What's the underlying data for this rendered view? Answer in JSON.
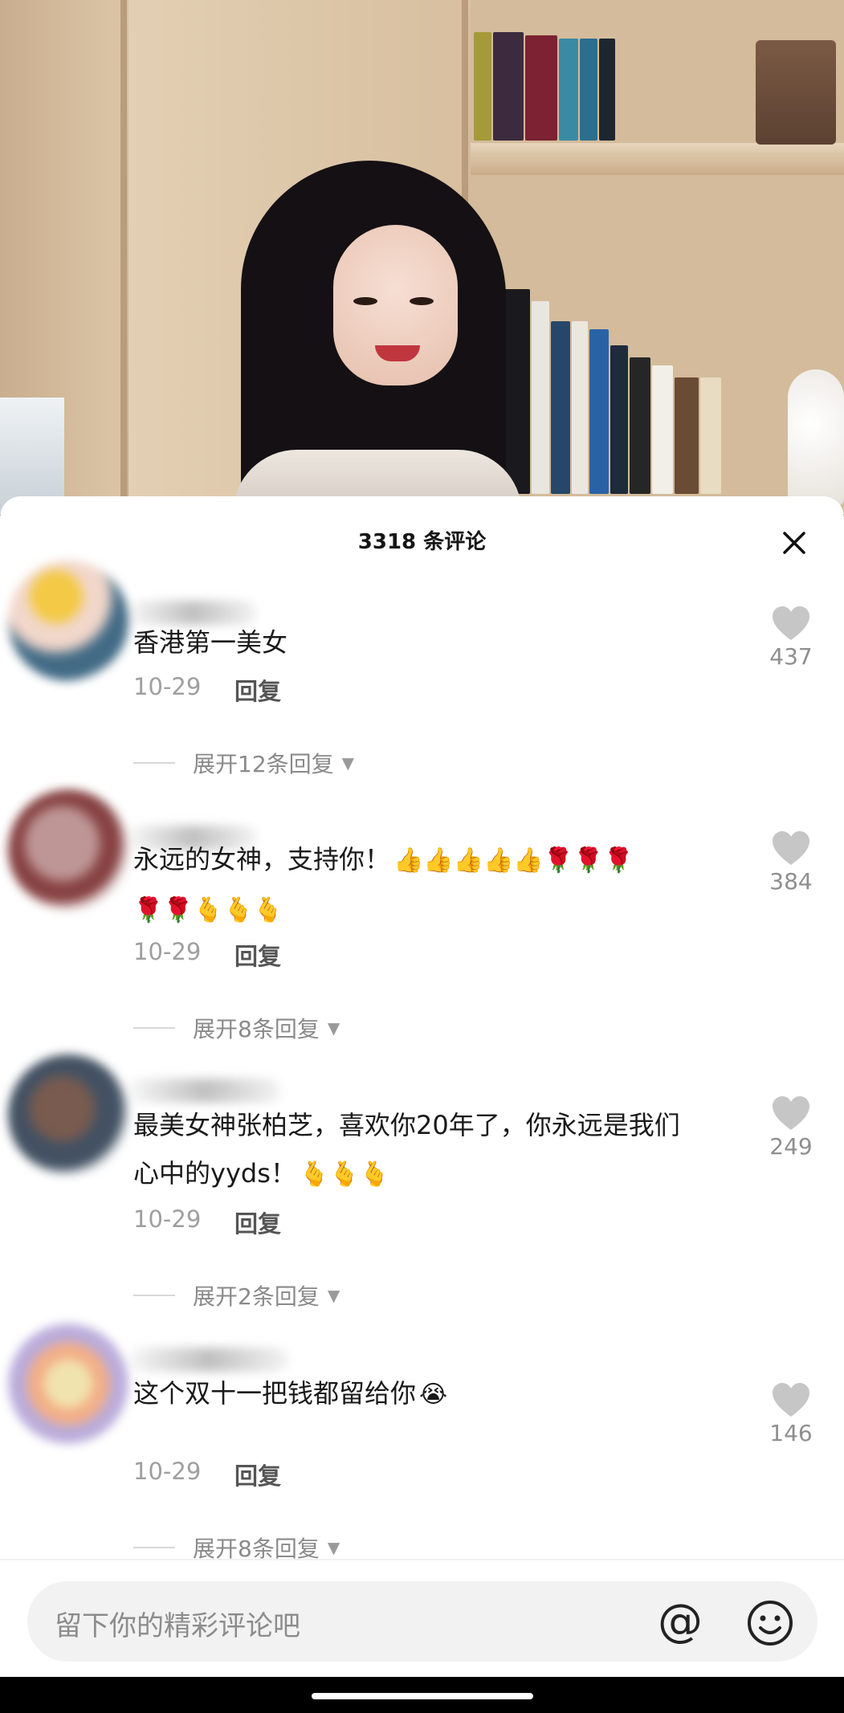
{
  "sheet": {
    "title": "3318 条评论"
  },
  "comments": [
    {
      "text": "香港第一美女",
      "emojis": "",
      "emojis_line2": "",
      "text_line2": "",
      "date": "10-29",
      "reply_label": "回复",
      "expand_label": "展开12条回复",
      "likes": "437"
    },
    {
      "text": "永远的女神，支持你！",
      "emojis": "👍👍👍👍👍🌹🌹🌹",
      "text_line2": "",
      "emojis_line2": "🌹🌹🫰🫰🫰",
      "date": "10-29",
      "reply_label": "回复",
      "expand_label": "展开8条回复",
      "likes": "384"
    },
    {
      "text": "最美女神张柏芝，喜欢你20年了，你永远是我们",
      "emojis": "",
      "text_line2": "心中的yyds！",
      "emojis_line2": "🫰🫰🫰",
      "date": "10-29",
      "reply_label": "回复",
      "expand_label": "展开2条回复",
      "likes": "249"
    },
    {
      "text": "这个双十一把钱都留给你",
      "emojis": "😭",
      "text_line2": "",
      "emojis_line2": "",
      "date": "10-29",
      "reply_label": "回复",
      "expand_label": "展开8条回复",
      "likes": "146"
    }
  ],
  "input": {
    "placeholder": "留下你的精彩评论吧",
    "at_symbol": "@"
  },
  "icons": {
    "close": "close-icon",
    "like": "heart-icon",
    "expand": "caret-down-icon",
    "emoji": "smiley-icon",
    "at": "at-icon"
  },
  "colors": {
    "like_gray": "#c6c6c6",
    "sheet_bg": "#ffffff",
    "input_bg": "#f2f2f2"
  }
}
